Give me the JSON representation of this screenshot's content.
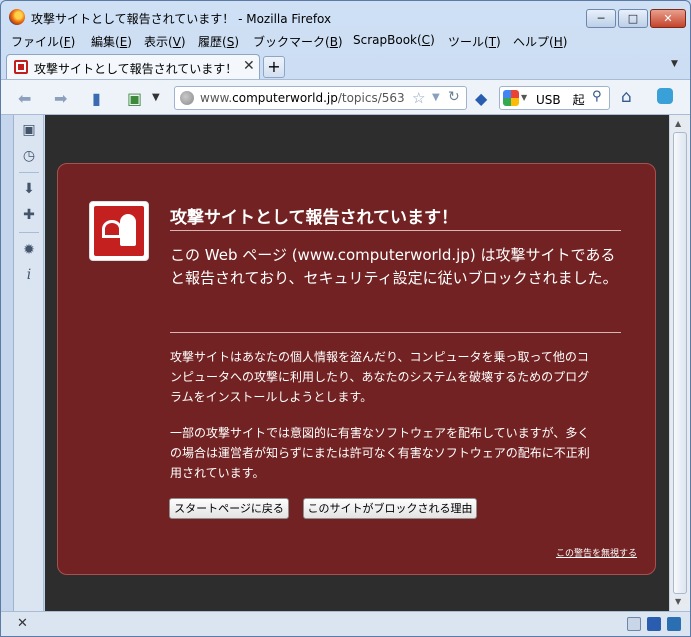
{
  "window": {
    "title": "攻撃サイトとして報告されています！ - Mozilla Firefox",
    "controls": {
      "minimize": "─",
      "maximize": "□",
      "close": "✕"
    }
  },
  "menubar": {
    "items": [
      {
        "label": "ファイル(",
        "key": "F",
        "suffix": ")"
      },
      {
        "label": "編集(",
        "key": "E",
        "suffix": ")"
      },
      {
        "label": "表示(",
        "key": "V",
        "suffix": ")"
      },
      {
        "label": "履歴(",
        "key": "S",
        "suffix": ")"
      },
      {
        "label": "ブックマーク(",
        "key": "B",
        "suffix": ")"
      },
      {
        "label": "ScrapBook(",
        "key": "C",
        "suffix": ")"
      },
      {
        "label": "ツール(",
        "key": "T",
        "suffix": ")"
      },
      {
        "label": "ヘルプ(",
        "key": "H",
        "suffix": ")"
      }
    ]
  },
  "tabs": {
    "active_label": "攻撃サイトとして報告されています！",
    "close_glyph": "✕",
    "new_tab_glyph": "+"
  },
  "navbar": {
    "url_prefix": "www.",
    "url_domain": "computerworld.jp",
    "url_path": "/topics/563",
    "search_text": "USB　起",
    "icons": [
      "back-icon",
      "forward-icon",
      "sidebar-icon",
      "scrapbook-icon",
      "bookmark-star-icon",
      "reload-icon",
      "home-icon"
    ]
  },
  "error_page": {
    "title": "攻撃サイトとして報告されています！",
    "short_desc": "この Web ページ (www.computerworld.jp) は攻撃サイトであると報告されており、セキュリティ設定に従いブロックされました。",
    "long_desc_1": "攻撃サイトはあなたの個人情報を盗んだり、コンピュータを乗っ取って他のコンピュータへの攻撃に利用したり、あなたのシステムを破壊するためのプログラムをインストールしようとします。",
    "long_desc_2": "一部の攻撃サイトでは意図的に有害なソフトウェアを配布していますが、多くの場合は運営者が知らずにまたは許可なく有害なソフトウェアの配布に不正利用されています。",
    "buttons": {
      "start_page": "スタートページに戻る",
      "why_blocked": "このサイトがブロックされる理由"
    },
    "ignore_link": "この警告を無視する",
    "colors": {
      "background": "#722222",
      "content_bg": "#2d2d2d"
    }
  },
  "statusbar": {
    "close_glyph": "✕"
  }
}
